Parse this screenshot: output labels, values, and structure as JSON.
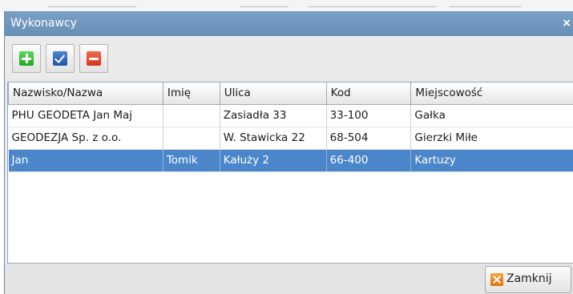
{
  "window": {
    "title": "Wykonawcy",
    "close_glyph": "×"
  },
  "toolbar": {
    "buttons": [
      {
        "icon": "plus-icon",
        "color": "#22b024"
      },
      {
        "icon": "checkmark-icon",
        "color": "#2a5fb0"
      },
      {
        "icon": "minus-icon",
        "color": "#e0401f"
      }
    ]
  },
  "table": {
    "columns": [
      "Nazwisko/Nazwa",
      "Imię",
      "Ulica",
      "Kod",
      "Miejscowość"
    ],
    "rows": [
      [
        "PHU GEODETA Jan Maj",
        "",
        "Zasiadła 33",
        "33-100",
        "Gałka"
      ],
      [
        "GEODEZJA Sp. z o.o.",
        "",
        "W. Stawicka 22",
        "68-504",
        "Gierzki Miłe"
      ],
      [
        "Jan",
        "Tomik",
        "Kałuży 2",
        "66-400",
        "Kartuzy"
      ]
    ],
    "selected_row": 2,
    "selection_color": "#4a86c9"
  },
  "footer": {
    "close_label": "Zamknij"
  }
}
